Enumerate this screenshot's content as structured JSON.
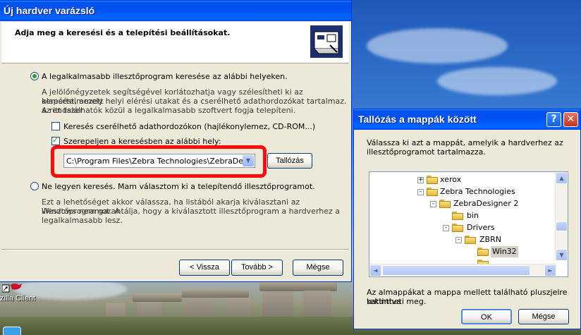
{
  "desktop": {
    "icon_label": "zilla Client"
  },
  "wizard": {
    "title": "Új hardver varázsló",
    "heading": "Adja meg a keresési és a telepítési beállításokat.",
    "option_search": {
      "label": "A legalkalmasabb illesztőprogram keresése az alábbi helyeken.",
      "selected": true,
      "description": [
        "A jelölőnégyzetek segítségével korlátozhatja vagy szélesítheti ki az alapértelmezett",
        "keresést, amely helyi elérési utakat és a cserélhető adathordozókat tartalmaz. A rendszer",
        "az itt találhatók közül a legalkalmasabb szoftvert fogja telepíteni."
      ]
    },
    "checkbox_removable": {
      "label": "Keresés cserélhető adathordozókon (hajlékonylemez, CD-ROM...)",
      "checked": false
    },
    "checkbox_location": {
      "label": "Szerepeljen a keresésben az alábbi hely:",
      "checked": true
    },
    "location_path": "C:\\Program Files\\Zebra Technologies\\ZebraDesigne",
    "browse_button": "Tallózás",
    "option_nosearch": {
      "label": "Ne legyen keresés. Mam választom ki a telepítendő illesztőprogramot.",
      "selected": false,
      "description": [
        "Ezt a lehetőséget akkor válassza, ha listából akarja kiválasztani az illesztőprogramot.  A",
        "Windows nem garantálja, hogy a kiválasztott illesztőprogram a hardverhez a",
        "legalkalmasabb lesz."
      ]
    },
    "buttons": {
      "back": "< Vissza",
      "next": "Tovább >",
      "cancel": "Mégse"
    }
  },
  "browse_dialog": {
    "title": "Tallózás a mappák között",
    "instruction": [
      "Válassza ki azt a mappát, amelyik a hardverhez az",
      "illesztőprogramot tartalmazza."
    ],
    "tree": [
      {
        "label": "xerox",
        "expander": "+"
      },
      {
        "label": "Zebra Technologies",
        "expander": "-"
      },
      {
        "label": "ZebraDesigner 2",
        "expander": "-"
      },
      {
        "label": "bin",
        "expander": ""
      },
      {
        "label": "Drivers",
        "expander": "-"
      },
      {
        "label": "ZBRN",
        "expander": "-"
      },
      {
        "label": "Win32",
        "expander": "",
        "selected": true
      }
    ],
    "hint": [
      "Az almappákat a mappa mellett található pluszjelre kattintva",
      "tekintheti meg."
    ],
    "buttons": {
      "ok": "OK",
      "cancel": "Mégse"
    },
    "title_buttons": {
      "help": "?",
      "close": "✕"
    }
  },
  "colors": {
    "title_bar": "#0054e3",
    "highlight_frame": "#ff0b0b",
    "dialog_face": "#ece9d8"
  }
}
